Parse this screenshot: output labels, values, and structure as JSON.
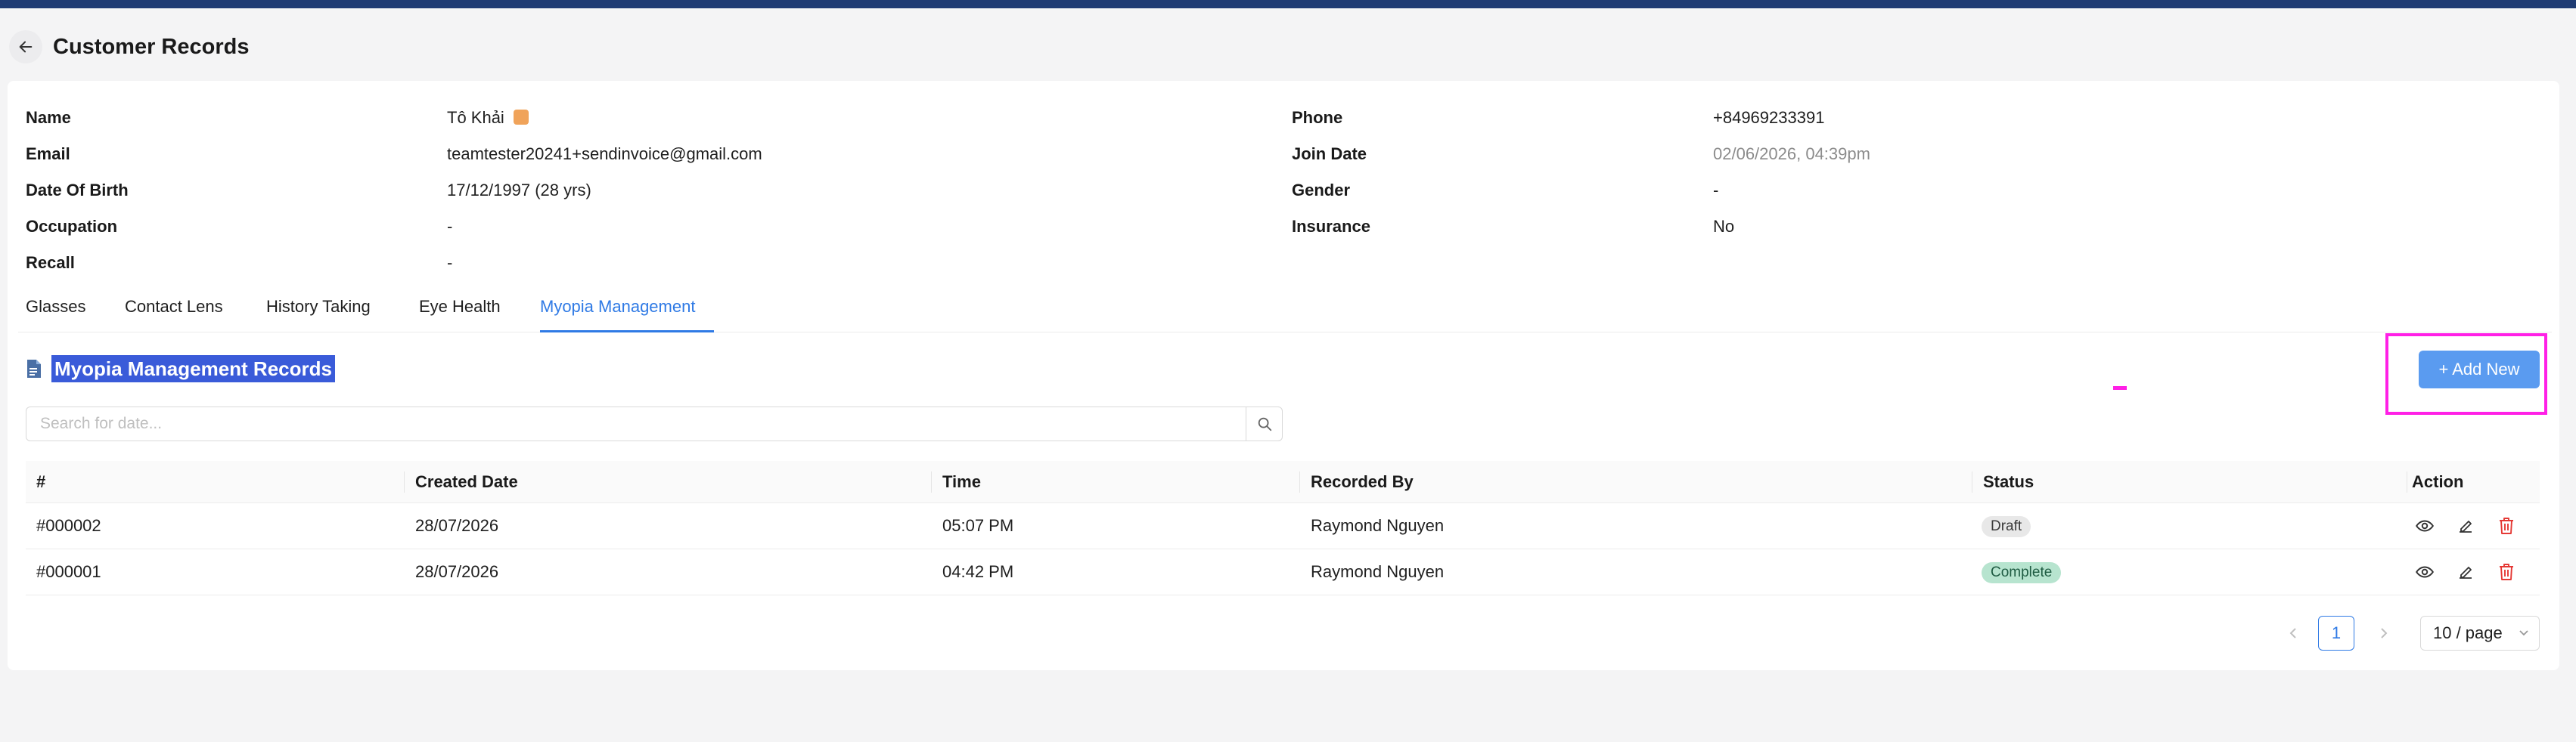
{
  "header": {
    "title": "Customer Records"
  },
  "profile": {
    "left": [
      {
        "label": "Name",
        "value": "Tô Khải"
      },
      {
        "label": "Email",
        "value": "teamtester20241+sendinvoice@gmail.com"
      },
      {
        "label": "Date Of Birth",
        "value": "17/12/1997 (28 yrs)"
      },
      {
        "label": "Occupation",
        "value": "-"
      },
      {
        "label": "Recall",
        "value": "-"
      }
    ],
    "right": [
      {
        "label": "Phone",
        "value": "+84969233391"
      },
      {
        "label": "Join Date",
        "value": "02/06/2026, 04:39pm"
      },
      {
        "label": "Gender",
        "value": "-"
      },
      {
        "label": "Insurance",
        "value": "No"
      }
    ],
    "name_badge_color": "#f0a35a"
  },
  "tabs": [
    {
      "label": "Glasses"
    },
    {
      "label": "Contact Lens"
    },
    {
      "label": "History Taking"
    },
    {
      "label": "Eye Health"
    },
    {
      "label": "Myopia Management"
    }
  ],
  "active_tab": "Myopia Management",
  "section": {
    "title": "Myopia Management Records",
    "add_button": "+ Add New",
    "search_placeholder": "Search for date..."
  },
  "table": {
    "columns": [
      "#",
      "Created Date",
      "Time",
      "Recorded By",
      "Status",
      "Action"
    ],
    "rows": [
      {
        "id": "#000002",
        "created_date": "28/07/2026",
        "time": "05:07 PM",
        "recorded_by": "Raymond Nguyen",
        "status": "Draft"
      },
      {
        "id": "#000001",
        "created_date": "28/07/2026",
        "time": "04:42 PM",
        "recorded_by": "Raymond Nguyen",
        "status": "Complete"
      }
    ]
  },
  "pagination": {
    "current_page": "1",
    "page_size": "10 / page"
  },
  "colors": {
    "accent": "#2f7ae5",
    "add_button": "#5a9bf0",
    "delete_icon": "#e53935",
    "highlight": "#ff20e6",
    "top_bar": "#1f3b73"
  }
}
